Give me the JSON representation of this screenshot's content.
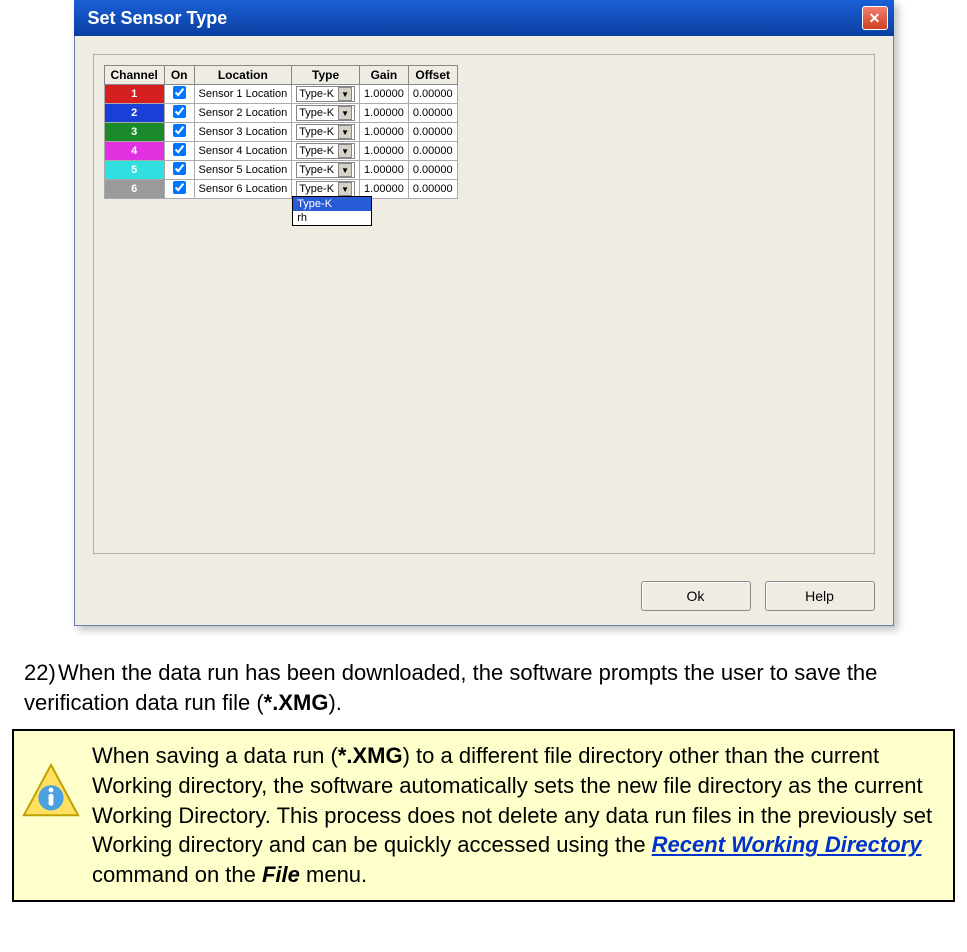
{
  "dialog": {
    "title": "Set Sensor Type",
    "close_glyph": "✕",
    "headers": {
      "channel": "Channel",
      "on": "On",
      "location": "Location",
      "type": "Type",
      "gain": "Gain",
      "offset": "Offset"
    },
    "rows": [
      {
        "num": "1",
        "color": "#d62020",
        "loc": "Sensor 1 Location",
        "type": "Type-K",
        "gain": "1.00000",
        "offset": "0.00000"
      },
      {
        "num": "2",
        "color": "#1a3fd6",
        "loc": "Sensor 2 Location",
        "type": "Type-K",
        "gain": "1.00000",
        "offset": "0.00000"
      },
      {
        "num": "3",
        "color": "#1a8a2a",
        "loc": "Sensor 3 Location",
        "type": "Type-K",
        "gain": "1.00000",
        "offset": "0.00000"
      },
      {
        "num": "4",
        "color": "#e030e0",
        "loc": "Sensor 4 Location",
        "type": "Type-K",
        "gain": "1.00000",
        "offset": "0.00000"
      },
      {
        "num": "5",
        "color": "#30e0e0",
        "loc": "Sensor 5 Location",
        "type": "Type-K",
        "gain": "1.00000",
        "offset": "0.00000"
      },
      {
        "num": "6",
        "color": "#9a9a9a",
        "loc": "Sensor 6 Location",
        "type": "Type-K",
        "gain": "1.00000",
        "offset": "0.00000"
      }
    ],
    "dropdown": {
      "opt_selected": "Type-K",
      "opt_other": "rh"
    },
    "buttons": {
      "ok": "Ok",
      "help": "Help"
    }
  },
  "doc": {
    "step_number": "22)",
    "step_text_a": "When the data run has been downloaded, the software prompts the user to save the verification data run file (",
    "step_text_ext": "*.XMG",
    "step_text_b": ")."
  },
  "note": {
    "t1": "When saving a data run (",
    "ext": "*.XMG",
    "t2": ") to a different file directory other than the current Working directory, the software automatically sets the new file directory as the current Working Directory. This process does not delete any data run files in the previously set Working directory and can be quickly accessed using the ",
    "link": "Recent Working Directory",
    "t3": " command on the ",
    "menu": "File",
    "t4": " menu."
  }
}
